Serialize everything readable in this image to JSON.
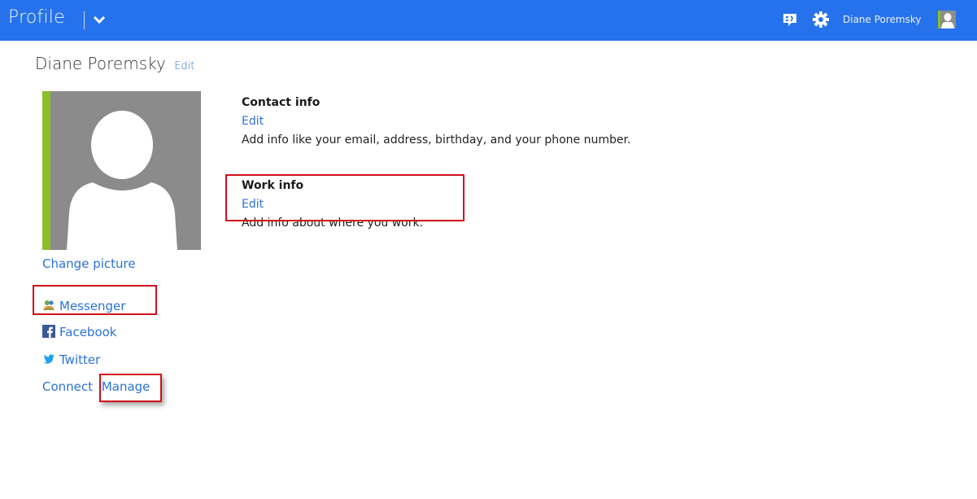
{
  "topbar": {
    "title": "Profile",
    "menu_icon": "chevron-down-icon",
    "feedback_icon": "feedback-icon",
    "settings_icon": "gear-icon",
    "user_name": "Diane Poremsky",
    "avatar_icon": "user-avatar-icon",
    "background_color": "#2672ec"
  },
  "profile": {
    "name": "Diane Poremsky",
    "edit_label": "Edit",
    "change_picture_label": "Change picture"
  },
  "social": {
    "items": [
      {
        "label": "Messenger",
        "icon": "messenger-icon"
      },
      {
        "label": "Facebook",
        "icon": "facebook-icon"
      },
      {
        "label": "Twitter",
        "icon": "twitter-icon"
      }
    ],
    "connect_label": "Connect",
    "manage_label": "Manage"
  },
  "sections": {
    "contact": {
      "heading": "Contact info",
      "edit_label": "Edit",
      "description": "Add info like your email, address, birthday, and your phone number."
    },
    "work": {
      "heading": "Work info",
      "edit_label": "Edit",
      "description": "Add info about where you work."
    }
  },
  "colors": {
    "accent": "#2a72d8",
    "highlight": "#d0101a",
    "avatar_bar": "#8cbf26"
  }
}
